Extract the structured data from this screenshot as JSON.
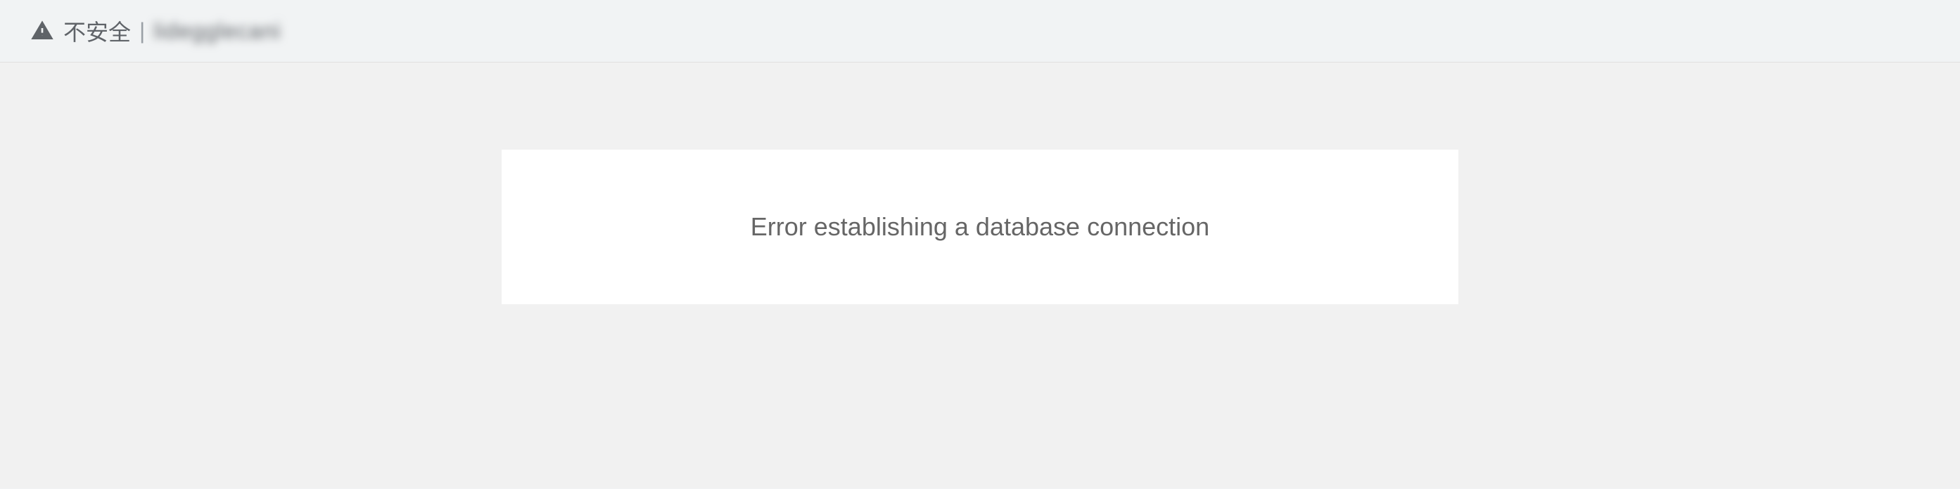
{
  "addressBar": {
    "securityLabel": "不安全",
    "separator": "|",
    "urlObscured": "lidegglecani"
  },
  "page": {
    "errorMessage": "Error establishing a database connection"
  }
}
